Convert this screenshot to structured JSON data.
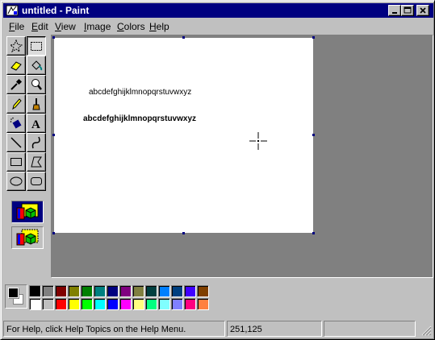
{
  "window": {
    "title": "untitled - Paint",
    "colors": {
      "titlebar": "#000080",
      "face": "#c0c0c0",
      "workspace": "#808080"
    }
  },
  "title_buttons": {
    "minimize": "minimize-icon",
    "maximize": "maximize-icon",
    "close": "close-icon"
  },
  "menu": {
    "items": [
      {
        "label": "File",
        "key": "F",
        "rest": "ile"
      },
      {
        "label": "Edit",
        "key": "E",
        "rest": "dit"
      },
      {
        "label": "View",
        "key": "V",
        "rest": "iew"
      },
      {
        "label": "Image",
        "key": "I",
        "rest": "mage"
      },
      {
        "label": "Colors",
        "key": "C",
        "rest": "olors"
      },
      {
        "label": "Help",
        "key": "H",
        "rest": "elp"
      }
    ]
  },
  "tools": [
    {
      "name": "free-form-select",
      "icon": "free-select-icon"
    },
    {
      "name": "select",
      "icon": "rect-select-icon"
    },
    {
      "name": "eraser",
      "icon": "eraser-icon"
    },
    {
      "name": "fill-with-color",
      "icon": "bucket-icon"
    },
    {
      "name": "pick-color",
      "icon": "eyedropper-icon"
    },
    {
      "name": "magnifier",
      "icon": "magnifier-icon"
    },
    {
      "name": "pencil",
      "icon": "pencil-icon"
    },
    {
      "name": "brush",
      "icon": "brush-icon"
    },
    {
      "name": "airbrush",
      "icon": "airbrush-icon"
    },
    {
      "name": "text",
      "icon": "text-icon",
      "glyph": "A",
      "selected": true
    },
    {
      "name": "line",
      "icon": "line-icon"
    },
    {
      "name": "curve",
      "icon": "curve-icon"
    },
    {
      "name": "rectangle",
      "icon": "rectangle-icon"
    },
    {
      "name": "polygon",
      "icon": "polygon-icon"
    },
    {
      "name": "ellipse",
      "icon": "ellipse-icon"
    },
    {
      "name": "rounded-rectangle",
      "icon": "rounded-rect-icon"
    }
  ],
  "tool_options": {
    "selected": "opaque-background",
    "options": [
      "opaque-background",
      "transparent-background"
    ]
  },
  "canvas": {
    "text_lines": [
      "abcdefghijklmnopqrstuvwxyz",
      "abcdefghijklmnopqrstuvwxyz"
    ]
  },
  "palette": {
    "foreground": "#000000",
    "background": "#ffffff",
    "row1": [
      "#000000",
      "#808080",
      "#800000",
      "#808000",
      "#008000",
      "#008080",
      "#000080",
      "#800080",
      "#808040",
      "#004040",
      "#0080ff",
      "#004080",
      "#4000ff",
      "#804000"
    ],
    "row2": [
      "#ffffff",
      "#c0c0c0",
      "#ff0000",
      "#ffff00",
      "#00ff00",
      "#00ffff",
      "#0000ff",
      "#ff00ff",
      "#ffff80",
      "#00ff80",
      "#80ffff",
      "#8080ff",
      "#ff0080",
      "#ff8040"
    ]
  },
  "status": {
    "help": "For Help, click Help Topics on the Help Menu.",
    "coords": "251,125",
    "extra": ""
  }
}
